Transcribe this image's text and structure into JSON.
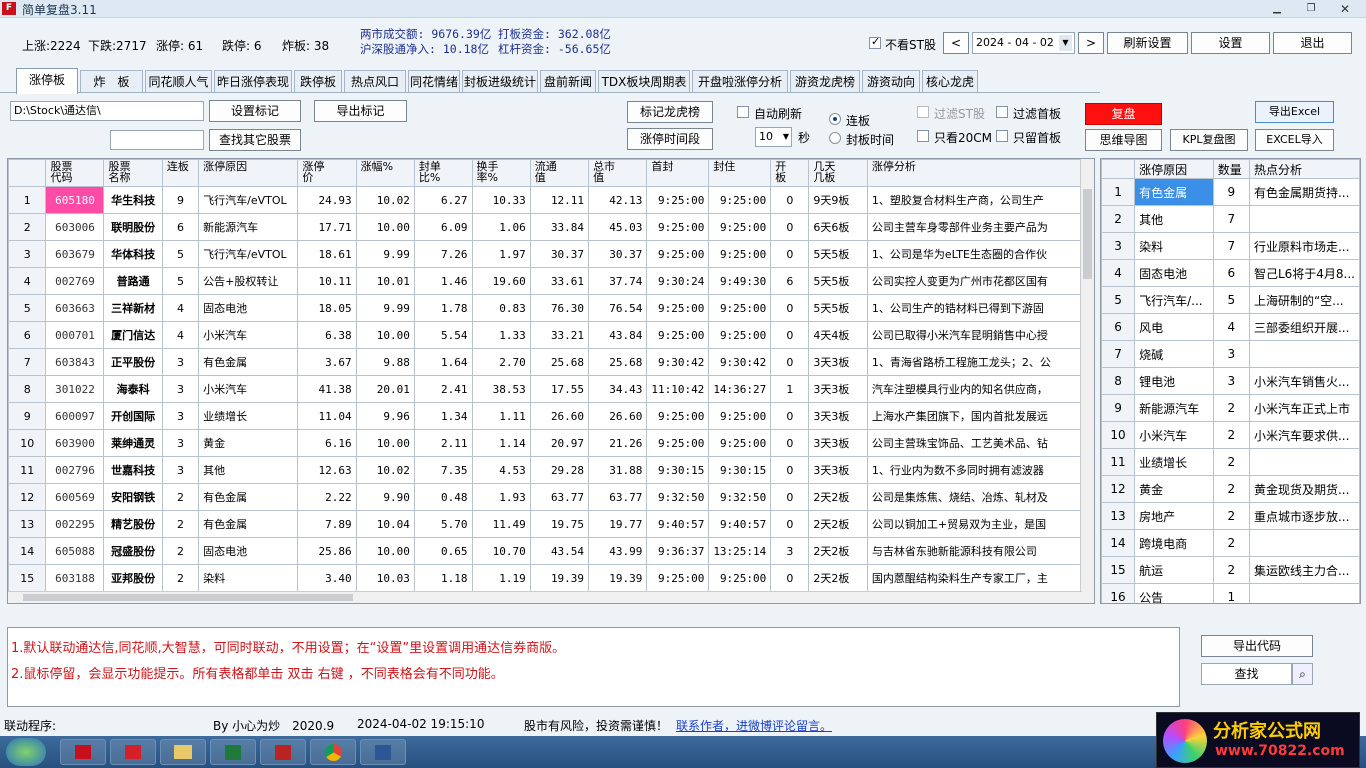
{
  "window": {
    "title": "简单复盘3.11",
    "icon_text": "F"
  },
  "stats": {
    "up": "上涨:2224",
    "down": "下跌:2717",
    "limit_up": "涨停: 61",
    "limit_down": "跌停: 6",
    "broken": "炸板: 38",
    "turnover": "两市成交额: 9676.39亿",
    "hk_inflow": "沪深股通净入: 10.18亿",
    "board_funds": "打板资金: 362.08亿",
    "leverage_funds": "杠杆资金: -56.65亿"
  },
  "topright": {
    "no_st_label": "不看ST股",
    "date": "2024 - 04 - 02",
    "refresh": "刷新设置",
    "settings": "设置",
    "exit": "退出",
    "prev": "<",
    "next": ">"
  },
  "tabs": [
    "涨停板",
    "炸　板",
    "同花顺人气",
    "昨日涨停表现",
    "跌停板",
    "热点风口",
    "同花情绪",
    "封板进级统计",
    "盘前新闻",
    "TDX板块周期表",
    "开盘啦涨停分析",
    "游资龙虎榜",
    "游资动向",
    "核心龙虎"
  ],
  "toolbar": {
    "path": "D:\\Stock\\通达信\\",
    "set_mark": "设置标记",
    "export_mark": "导出标记",
    "find_other": "查找其它股票",
    "mark_lhb": "标记龙虎榜",
    "limit_time": "涨停时间段",
    "auto_refresh": "自动刷新",
    "interval": "10",
    "sec": "秒",
    "radio_streak": "连板",
    "radio_time": "封板时间",
    "filter_st": "过滤ST股",
    "filter_first": "过滤首板",
    "only_20cm": "只看20CM",
    "only_first": "只留首板",
    "fupan": "复盘",
    "mind_map": "思维导图",
    "kpl": "KPL复盘图",
    "export_excel": "导出Excel",
    "import_excel": "EXCEL导入"
  },
  "grid": {
    "headers": [
      "",
      "股票\n代码",
      "股票\n名称",
      "连板",
      "涨停原因",
      "涨停\n价",
      "涨幅%",
      "封单\n比%",
      "换手\n率%",
      "流通\n值",
      "总市\n值",
      "首封",
      "封住",
      "开\n板",
      "几天\n几板",
      "涨停分析"
    ],
    "rows": [
      [
        "1",
        "605180",
        "华生科技",
        "9",
        "飞行汽车/eVTOL",
        "24.93",
        "10.02",
        "6.27",
        "10.33",
        "12.11",
        "42.13",
        "9:25:00",
        "9:25:00",
        "0",
        "9天9板",
        "1、塑胶复合材料生产商，公司生产"
      ],
      [
        "2",
        "603006",
        "联明股份",
        "6",
        "新能源汽车",
        "17.71",
        "10.00",
        "6.09",
        "1.06",
        "33.84",
        "45.03",
        "9:25:00",
        "9:25:00",
        "0",
        "6天6板",
        "公司主营车身零部件业务主要产品为"
      ],
      [
        "3",
        "603679",
        "华体科技",
        "5",
        "飞行汽车/eVTOL",
        "18.61",
        "9.99",
        "7.26",
        "1.97",
        "30.37",
        "30.37",
        "9:25:00",
        "9:25:00",
        "0",
        "5天5板",
        "1、公司是华为eLTE生态圈的合作伙"
      ],
      [
        "4",
        "002769",
        "普路通",
        "5",
        "公告+股权转让",
        "10.11",
        "10.01",
        "1.46",
        "19.60",
        "33.61",
        "37.74",
        "9:30:24",
        "9:49:30",
        "6",
        "5天5板",
        "公司实控人变更为广州市花都区国有"
      ],
      [
        "5",
        "603663",
        "三祥新材",
        "4",
        "固态电池",
        "18.05",
        "9.99",
        "1.78",
        "0.83",
        "76.30",
        "76.54",
        "9:25:00",
        "9:25:00",
        "0",
        "5天5板",
        "1、公司生产的锆材料已得到下游固"
      ],
      [
        "6",
        "000701",
        "厦门信达",
        "4",
        "小米汽车",
        "6.38",
        "10.00",
        "5.54",
        "1.33",
        "33.21",
        "43.84",
        "9:25:00",
        "9:25:00",
        "0",
        "4天4板",
        "公司已取得小米汽车昆明銷售中心授"
      ],
      [
        "7",
        "603843",
        "正平股份",
        "3",
        "有色金属",
        "3.67",
        "9.88",
        "1.64",
        "2.70",
        "25.68",
        "25.68",
        "9:30:42",
        "9:30:42",
        "0",
        "3天3板",
        "1、青海省路桥工程施工龙头；2、公"
      ],
      [
        "8",
        "301022",
        "海泰科",
        "3",
        "小米汽车",
        "41.38",
        "20.01",
        "2.41",
        "38.53",
        "17.55",
        "34.43",
        "11:10:42",
        "14:36:27",
        "1",
        "3天3板",
        "汽车注塑模具行业内的知名供应商，"
      ],
      [
        "9",
        "600097",
        "开创国际",
        "3",
        "业绩增长",
        "11.04",
        "9.96",
        "1.34",
        "1.11",
        "26.60",
        "26.60",
        "9:25:00",
        "9:25:00",
        "0",
        "3天3板",
        "上海水产集团旗下，国内首批发展远"
      ],
      [
        "10",
        "603900",
        "莱绅通灵",
        "3",
        "黄金",
        "6.16",
        "10.00",
        "2.11",
        "1.14",
        "20.97",
        "21.26",
        "9:25:00",
        "9:25:00",
        "0",
        "3天3板",
        "公司主营珠宝饰品、工艺美术品、钻"
      ],
      [
        "11",
        "002796",
        "世嘉科技",
        "3",
        "其他",
        "12.63",
        "10.02",
        "7.35",
        "4.53",
        "29.28",
        "31.88",
        "9:30:15",
        "9:30:15",
        "0",
        "3天3板",
        "1、行业内为数不多同时拥有滤波器"
      ],
      [
        "12",
        "600569",
        "安阳钢铁",
        "2",
        "有色金属",
        "2.22",
        "9.90",
        "0.48",
        "1.93",
        "63.77",
        "63.77",
        "9:32:50",
        "9:32:50",
        "0",
        "2天2板",
        "公司是集炼焦、烧结、冶炼、轧材及"
      ],
      [
        "13",
        "002295",
        "精艺股份",
        "2",
        "有色金属",
        "7.89",
        "10.04",
        "5.70",
        "11.49",
        "19.75",
        "19.77",
        "9:40:57",
        "9:40:57",
        "0",
        "2天2板",
        "公司以铜加工+贸易双为主业，是国"
      ],
      [
        "14",
        "605088",
        "冠盛股份",
        "2",
        "固态电池",
        "25.86",
        "10.00",
        "0.65",
        "10.70",
        "43.54",
        "43.99",
        "9:36:37",
        "13:25:14",
        "3",
        "2天2板",
        "与吉林省东驰新能源科技有限公司"
      ],
      [
        "15",
        "603188",
        "亚邦股份",
        "2",
        "染料",
        "3.40",
        "10.03",
        "1.18",
        "1.19",
        "19.39",
        "19.39",
        "9:25:00",
        "9:25:00",
        "0",
        "2天2板",
        "国内蒽醌结构染料生产专家工厂，主"
      ]
    ]
  },
  "side": {
    "headers": [
      "",
      "涨停原因",
      "数量",
      "热点分析"
    ],
    "rows": [
      [
        "1",
        "有色金属",
        "9",
        "有色金属期货持..."
      ],
      [
        "2",
        "其他",
        "7",
        ""
      ],
      [
        "3",
        "染料",
        "7",
        "行业原料市场走..."
      ],
      [
        "4",
        "固态电池",
        "6",
        "智己L6将于4月8..."
      ],
      [
        "5",
        "飞行汽车/...",
        "5",
        "上海研制的“空..."
      ],
      [
        "6",
        "风电",
        "4",
        "三部委组织开展..."
      ],
      [
        "7",
        "烧碱",
        "3",
        ""
      ],
      [
        "8",
        "锂电池",
        "3",
        "小米汽车销售火..."
      ],
      [
        "9",
        "新能源汽车",
        "2",
        "小米汽车正式上市"
      ],
      [
        "10",
        "小米汽车",
        "2",
        "小米汽车要求供..."
      ],
      [
        "11",
        "业绩增长",
        "2",
        ""
      ],
      [
        "12",
        "黄金",
        "2",
        "黄金现货及期货..."
      ],
      [
        "13",
        "房地产",
        "2",
        "重点城市逐步放..."
      ],
      [
        "14",
        "跨境电商",
        "2",
        ""
      ],
      [
        "15",
        "航运",
        "2",
        "集运欧线主力合..."
      ],
      [
        "16",
        "公告",
        "1",
        ""
      ]
    ]
  },
  "info": {
    "line1": "1.默认联动通达信,同花顺,大智慧，可同时联动，不用设置；在“设置”里设置调用通达信券商版。",
    "line2": "2.鼠标停留，会显示功能提示。所有表格都单击 双击 右键 ，不同表格会有不同功能。",
    "export_code": "导出代码",
    "search": "查找"
  },
  "status": {
    "link": "联动程序:",
    "author": "By 小心为炒　2020.9",
    "datetime": "2024-04-02 19:15:10",
    "risk": "股市有风险，投资需谨慎！",
    "contact": "联系作者，进微博评论留言。"
  },
  "logo": {
    "name": "分析家公式网",
    "url": "www.70822.com"
  },
  "colors": {
    "highlight_code": "#ff4aa6",
    "side_selected": "#3b8fe6",
    "fupan_btn": "#ff1010",
    "info_red": "#d0141a"
  }
}
